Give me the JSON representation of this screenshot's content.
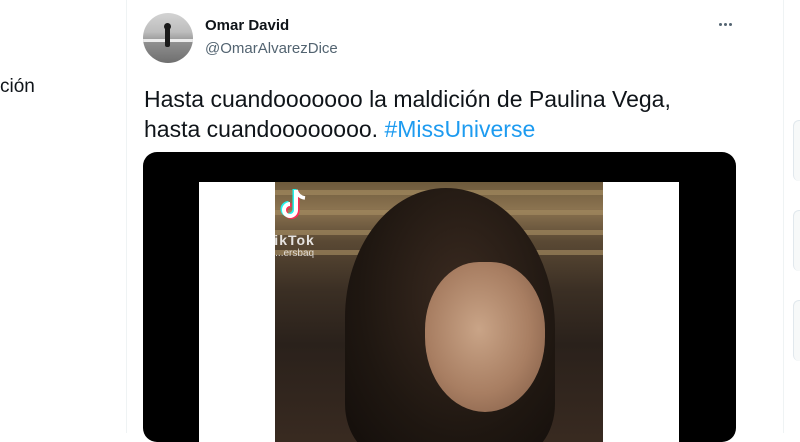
{
  "left_nav": {
    "partial_label": "ción"
  },
  "tweet": {
    "author_name": "Omar David",
    "author_handle": "@OmarAlvarezDice",
    "text_line1": "Hasta cuandooooooo la maldición de Paulina Vega,",
    "text_line2_plain": "hasta cuandoooooooo.",
    "hashtag": "#MissUniverse",
    "media": {
      "watermark_app": "TikTok",
      "watermark_user": "@...ersbaq"
    }
  },
  "icons": [
    "more-options-icon",
    "tiktok-logo-icon"
  ],
  "colors": {
    "accent": "#1d9bf0",
    "text": "#0f1419",
    "muted": "#536471",
    "border": "#eff3f4"
  }
}
